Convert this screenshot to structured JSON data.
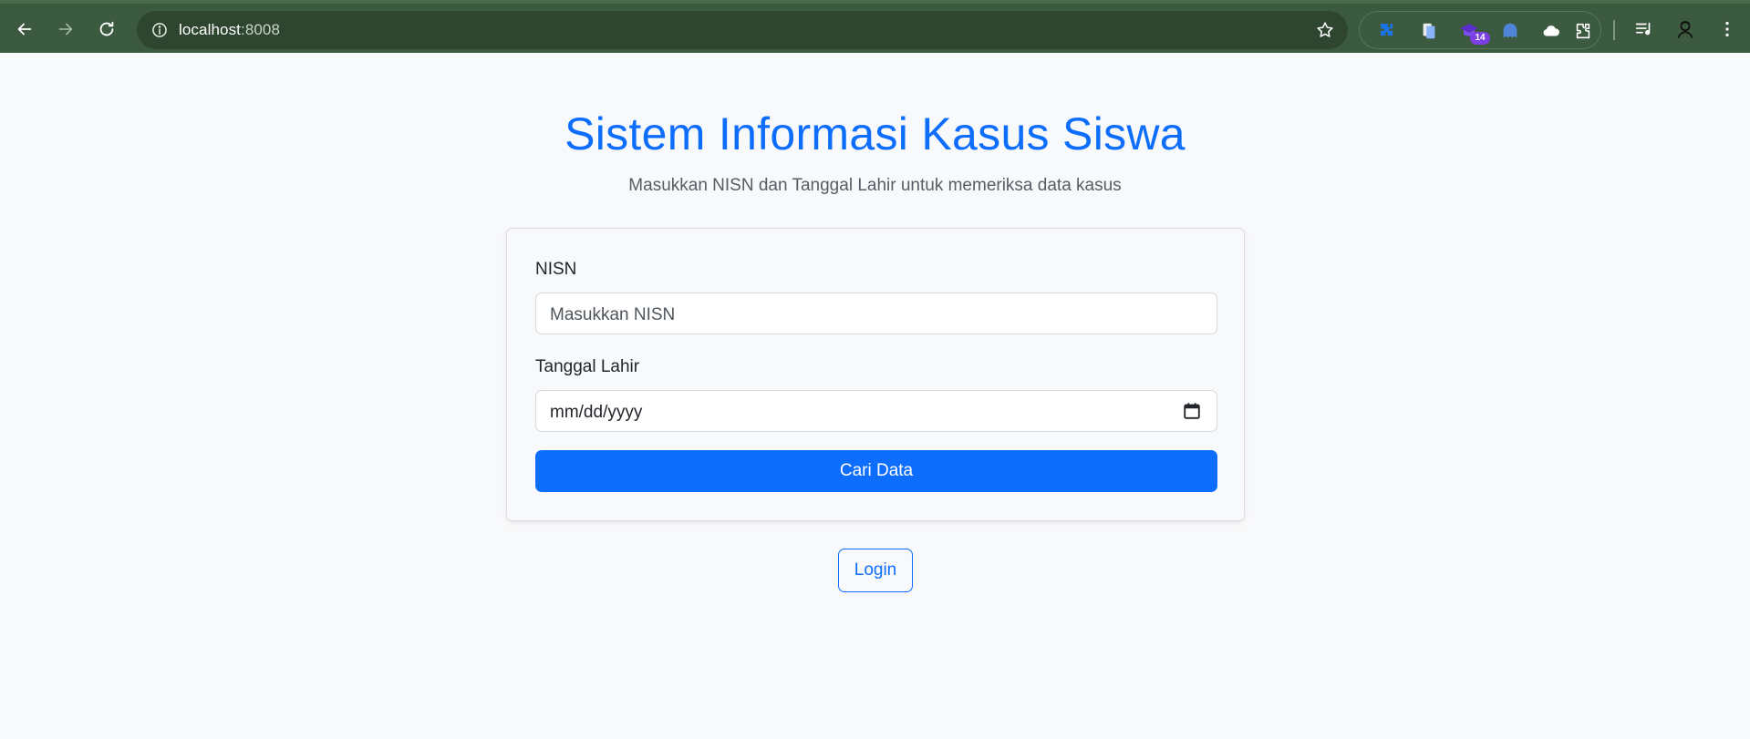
{
  "browser": {
    "url_host": "localhost",
    "url_port": ":8008",
    "extension_badge": "14",
    "icons": [
      "back-icon",
      "forward-icon",
      "reload-icon",
      "site-info-icon",
      "bookmark-star-icon",
      "extension-puzzle-icon",
      "document-extension-icon",
      "graduation-cap-icon",
      "ghost-extension-icon",
      "cloud-extension-icon",
      "extensions-menu-icon",
      "reading-list-icon",
      "profile-avatar-icon",
      "more-menu-icon"
    ]
  },
  "page": {
    "title": "Sistem Informasi Kasus Siswa",
    "subtitle": "Masukkan NISN dan Tanggal Lahir untuk memeriksa data kasus"
  },
  "form": {
    "nisn_label": "NISN",
    "nisn_placeholder": "Masukkan NISN",
    "dob_label": "Tanggal Lahir",
    "dob_placeholder": "mm/dd/yyyy",
    "submit_label": "Cari Data"
  },
  "login_label": "Login",
  "colors": {
    "primary": "#0d6efd",
    "page_background": "#f8f9fa",
    "browser_frame": "#3c5a3f"
  }
}
